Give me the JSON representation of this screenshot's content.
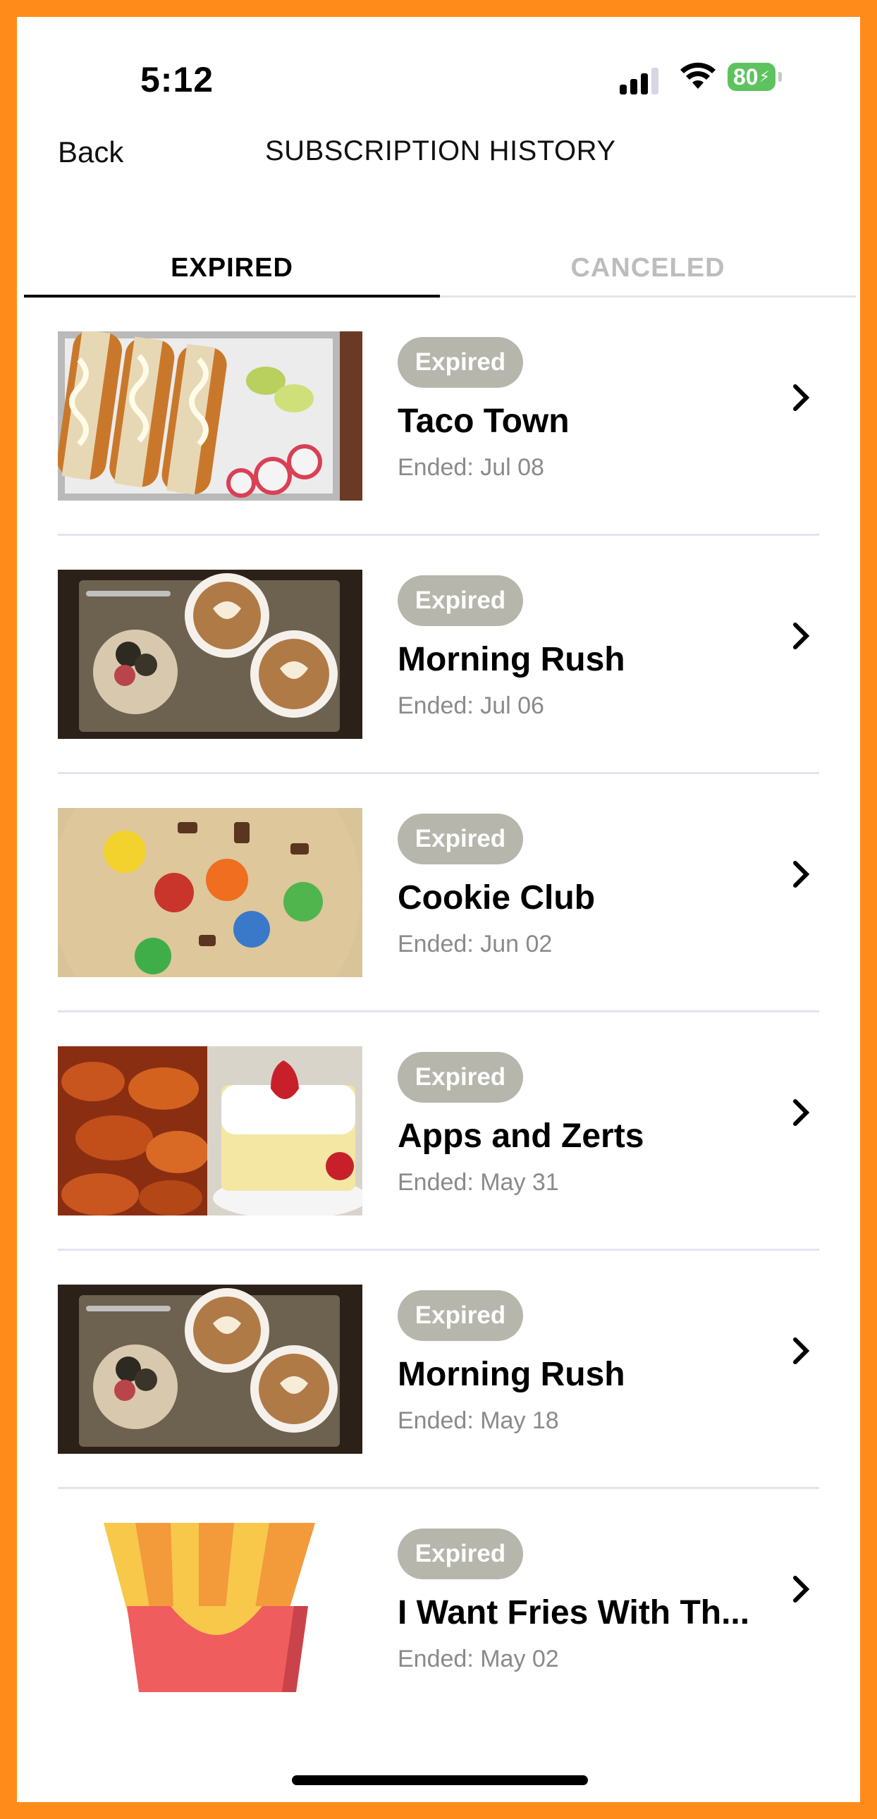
{
  "status_bar": {
    "time": "5:12",
    "battery": "80"
  },
  "header": {
    "back_label": "Back",
    "title": "SUBSCRIPTION HISTORY"
  },
  "tabs": [
    {
      "label": "EXPIRED",
      "active": true
    },
    {
      "label": "CANCELED",
      "active": false
    }
  ],
  "subscriptions": [
    {
      "badge": "Expired",
      "name": "Taco Town",
      "ended": "Ended: Jul 08",
      "image": "tacos-photo"
    },
    {
      "badge": "Expired",
      "name": "Morning Rush",
      "ended": "Ended: Jul 06",
      "image": "coffee-photo"
    },
    {
      "badge": "Expired",
      "name": "Cookie Club",
      "ended": "Ended: Jun 02",
      "image": "cookie-photo"
    },
    {
      "badge": "Expired",
      "name": "Apps and Zerts",
      "ended": "Ended: May 31",
      "image": "wings-and-cake-photo"
    },
    {
      "badge": "Expired",
      "name": "Morning Rush",
      "ended": "Ended: May 18",
      "image": "coffee-photo"
    },
    {
      "badge": "Expired",
      "name": "I Want Fries With Th...",
      "ended": "Ended: May 02",
      "image": "fries-illustration"
    }
  ],
  "colors": {
    "frame": "#FF8C1A",
    "badge_bg": "#B6B6AC",
    "inactive_tab": "#BDBDBD",
    "battery": "#5DC35F"
  }
}
